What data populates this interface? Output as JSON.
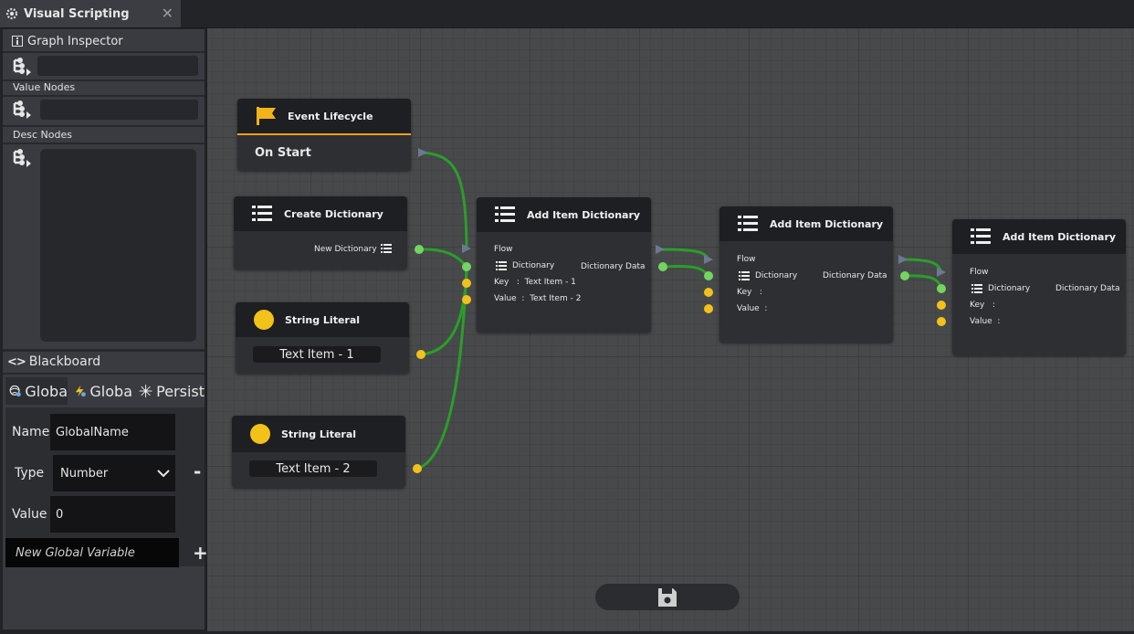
{
  "tab": {
    "title": "Visual Scripting",
    "close": "✕"
  },
  "inspector": {
    "title": "Graph Inspector",
    "value_nodes_label": "Value Nodes",
    "desc_nodes_label": "Desc Nodes"
  },
  "blackboard": {
    "title": "Blackboard",
    "tabs": [
      "Globa",
      "Globa",
      "Persist"
    ],
    "name_label": "Name",
    "name_value": "GlobalName",
    "type_label": "Type",
    "type_value": "Number",
    "value_label": "Value",
    "value_value": "0",
    "new_var_placeholder": "New Global Variable",
    "add": "+",
    "remove": "-"
  },
  "nodes": {
    "event": {
      "title": "Event Lifecycle",
      "output": "On Start"
    },
    "create_dict": {
      "title": "Create Dictionary",
      "output": "New Dictionary"
    },
    "string1": {
      "title": "String Literal",
      "value": "Text Item - 1"
    },
    "string2": {
      "title": "String Literal",
      "value": "Text Item - 2"
    },
    "add1": {
      "title": "Add Item Dictionary",
      "flow": "Flow",
      "dict": "Dictionary",
      "out": "Dictionary Data",
      "key": "Key   :  Text Item - 1",
      "value": "Value  :  Text Item - 2"
    },
    "add2": {
      "title": "Add Item Dictionary",
      "flow": "Flow",
      "dict": "Dictionary",
      "out": "Dictionary Data",
      "key": "Key   :",
      "value": "Value  :"
    },
    "add3": {
      "title": "Add Item Dictionary",
      "flow": "Flow",
      "dict": "Dictionary",
      "out": "Dictionary Data",
      "key": "Key   :",
      "value": "Value  :"
    }
  },
  "colors": {
    "accent_orange": "#f2a21a",
    "port_green": "#74d463",
    "port_yellow": "#f2c21a",
    "wire_green": "#2a9e2a"
  }
}
